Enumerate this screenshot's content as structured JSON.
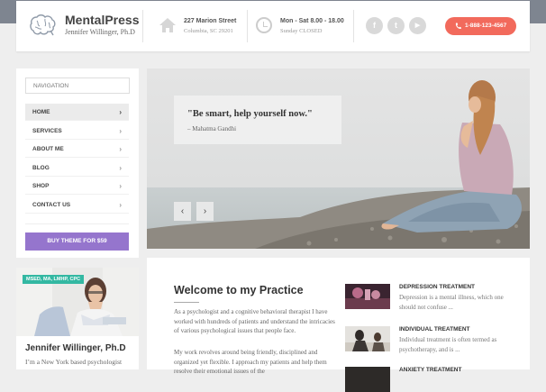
{
  "brand": {
    "title": "MentalPress",
    "subtitle": "Jennifer Willinger, Ph.D",
    "logo_icon": "brain-icon"
  },
  "header": {
    "address_line1": "227 Marion Street",
    "address_line2": "Columbia, SC 29201",
    "address_icon": "home-icon",
    "hours_line1": "Mon - Sat 8.00 - 18.00",
    "hours_line2": "Sunday CLOSED",
    "hours_icon": "clock-icon",
    "social": [
      {
        "name": "facebook-icon",
        "glyph": "f"
      },
      {
        "name": "twitter-icon",
        "glyph": "t"
      },
      {
        "name": "youtube-icon",
        "glyph": "▶"
      }
    ],
    "phone": "1-888-123-4567",
    "accent_color": "#f26a5c"
  },
  "sidebar": {
    "nav_placeholder": "NAVIGATION",
    "items": [
      {
        "label": "HOME",
        "active": true
      },
      {
        "label": "SERVICES",
        "active": false
      },
      {
        "label": "ABOUT ME",
        "active": false
      },
      {
        "label": "BLOG",
        "active": false
      },
      {
        "label": "SHOP",
        "active": false
      },
      {
        "label": "CONTACT US",
        "active": false
      }
    ],
    "buy_button": "BUY THEME FOR $59",
    "buy_color": "#9575cd"
  },
  "profile": {
    "badge": "MSED, MA, LMHP, CPC",
    "name": "Jennifer Willinger, Ph.D",
    "text": "I’m a New York based psychologist"
  },
  "slider": {
    "quote": "\"Be smart, help yourself now.\"",
    "author": "– Mahatma Gandhi",
    "prev": "‹",
    "next": "›"
  },
  "main": {
    "heading": "Welcome to my Practice",
    "paragraphs": [
      "As a psychologist and a cognitive behavioral therapist I have worked with hundreds of patients and understand the intricacies of various psychological issues that people face.",
      "My work revolves around being friendly, disciplined and organized yet flexible. I approach my patients and help them resolve their emotional issues of the"
    ],
    "services": [
      {
        "title": "DEPRESSION TREATMENT",
        "desc": "Depression is a mental illness, which one should not confuse ..."
      },
      {
        "title": "INDIVIDUAL TREATMENT",
        "desc": "Individual treatment is often termed as psychotherapy, and is ..."
      },
      {
        "title": "ANXIETY TREATMENT",
        "desc": ""
      }
    ]
  }
}
